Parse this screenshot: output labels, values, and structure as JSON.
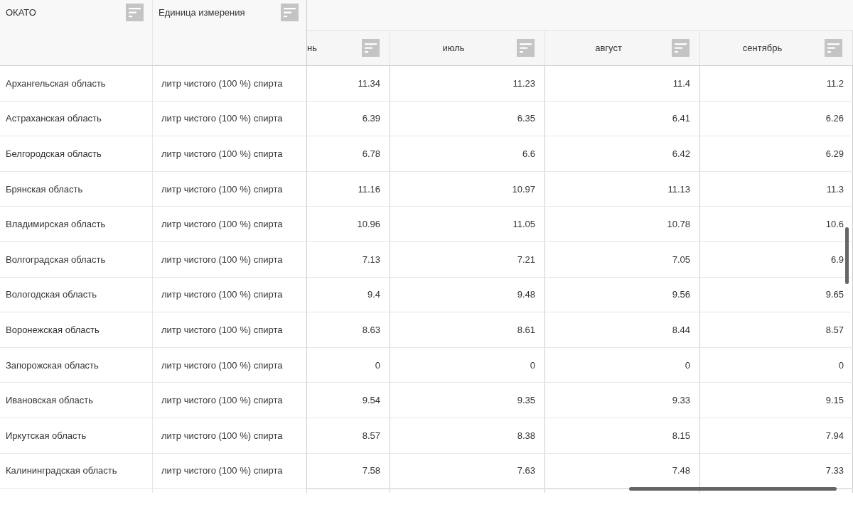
{
  "frozen_columns": [
    {
      "label": "ОКАТО"
    },
    {
      "label": "Единица измерения"
    }
  ],
  "columns": [
    {
      "label": "нь"
    },
    {
      "label": "июль"
    },
    {
      "label": "август"
    },
    {
      "label": "сентябрь"
    }
  ],
  "rows": [
    {
      "region": "Архангельская область",
      "unit": "литр чистого (100 %) спирта",
      "values": [
        "11.34",
        "11.23",
        "11.4",
        "11.2"
      ]
    },
    {
      "region": "Астраханская область",
      "unit": "литр чистого (100 %) спирта",
      "values": [
        "6.39",
        "6.35",
        "6.41",
        "6.26"
      ]
    },
    {
      "region": "Белгородская область",
      "unit": "литр чистого (100 %) спирта",
      "values": [
        "6.78",
        "6.6",
        "6.42",
        "6.29"
      ]
    },
    {
      "region": "Брянская область",
      "unit": "литр чистого (100 %) спирта",
      "values": [
        "11.16",
        "10.97",
        "11.13",
        "11.3"
      ]
    },
    {
      "region": "Владимирская область",
      "unit": "литр чистого (100 %) спирта",
      "values": [
        "10.96",
        "11.05",
        "10.78",
        "10.6"
      ]
    },
    {
      "region": "Волгоградская область",
      "unit": "литр чистого (100 %) спирта",
      "values": [
        "7.13",
        "7.21",
        "7.05",
        "6.9"
      ]
    },
    {
      "region": "Вологодская область",
      "unit": "литр чистого (100 %) спирта",
      "values": [
        "9.4",
        "9.48",
        "9.56",
        "9.65"
      ]
    },
    {
      "region": "Воронежская область",
      "unit": "литр чистого (100 %) спирта",
      "values": [
        "8.63",
        "8.61",
        "8.44",
        "8.57"
      ]
    },
    {
      "region": "Запорожская область",
      "unit": "литр чистого (100 %) спирта",
      "values": [
        "0",
        "0",
        "0",
        "0"
      ]
    },
    {
      "region": "Ивановская область",
      "unit": "литр чистого (100 %) спирта",
      "values": [
        "9.54",
        "9.35",
        "9.33",
        "9.15"
      ]
    },
    {
      "region": "Иркутская область",
      "unit": "литр чистого (100 %) спирта",
      "values": [
        "8.57",
        "8.38",
        "8.15",
        "7.94"
      ]
    },
    {
      "region": "Калининградская область",
      "unit": "литр чистого (100 %) спирта",
      "values": [
        "7.58",
        "7.63",
        "7.48",
        "7.33"
      ]
    }
  ]
}
